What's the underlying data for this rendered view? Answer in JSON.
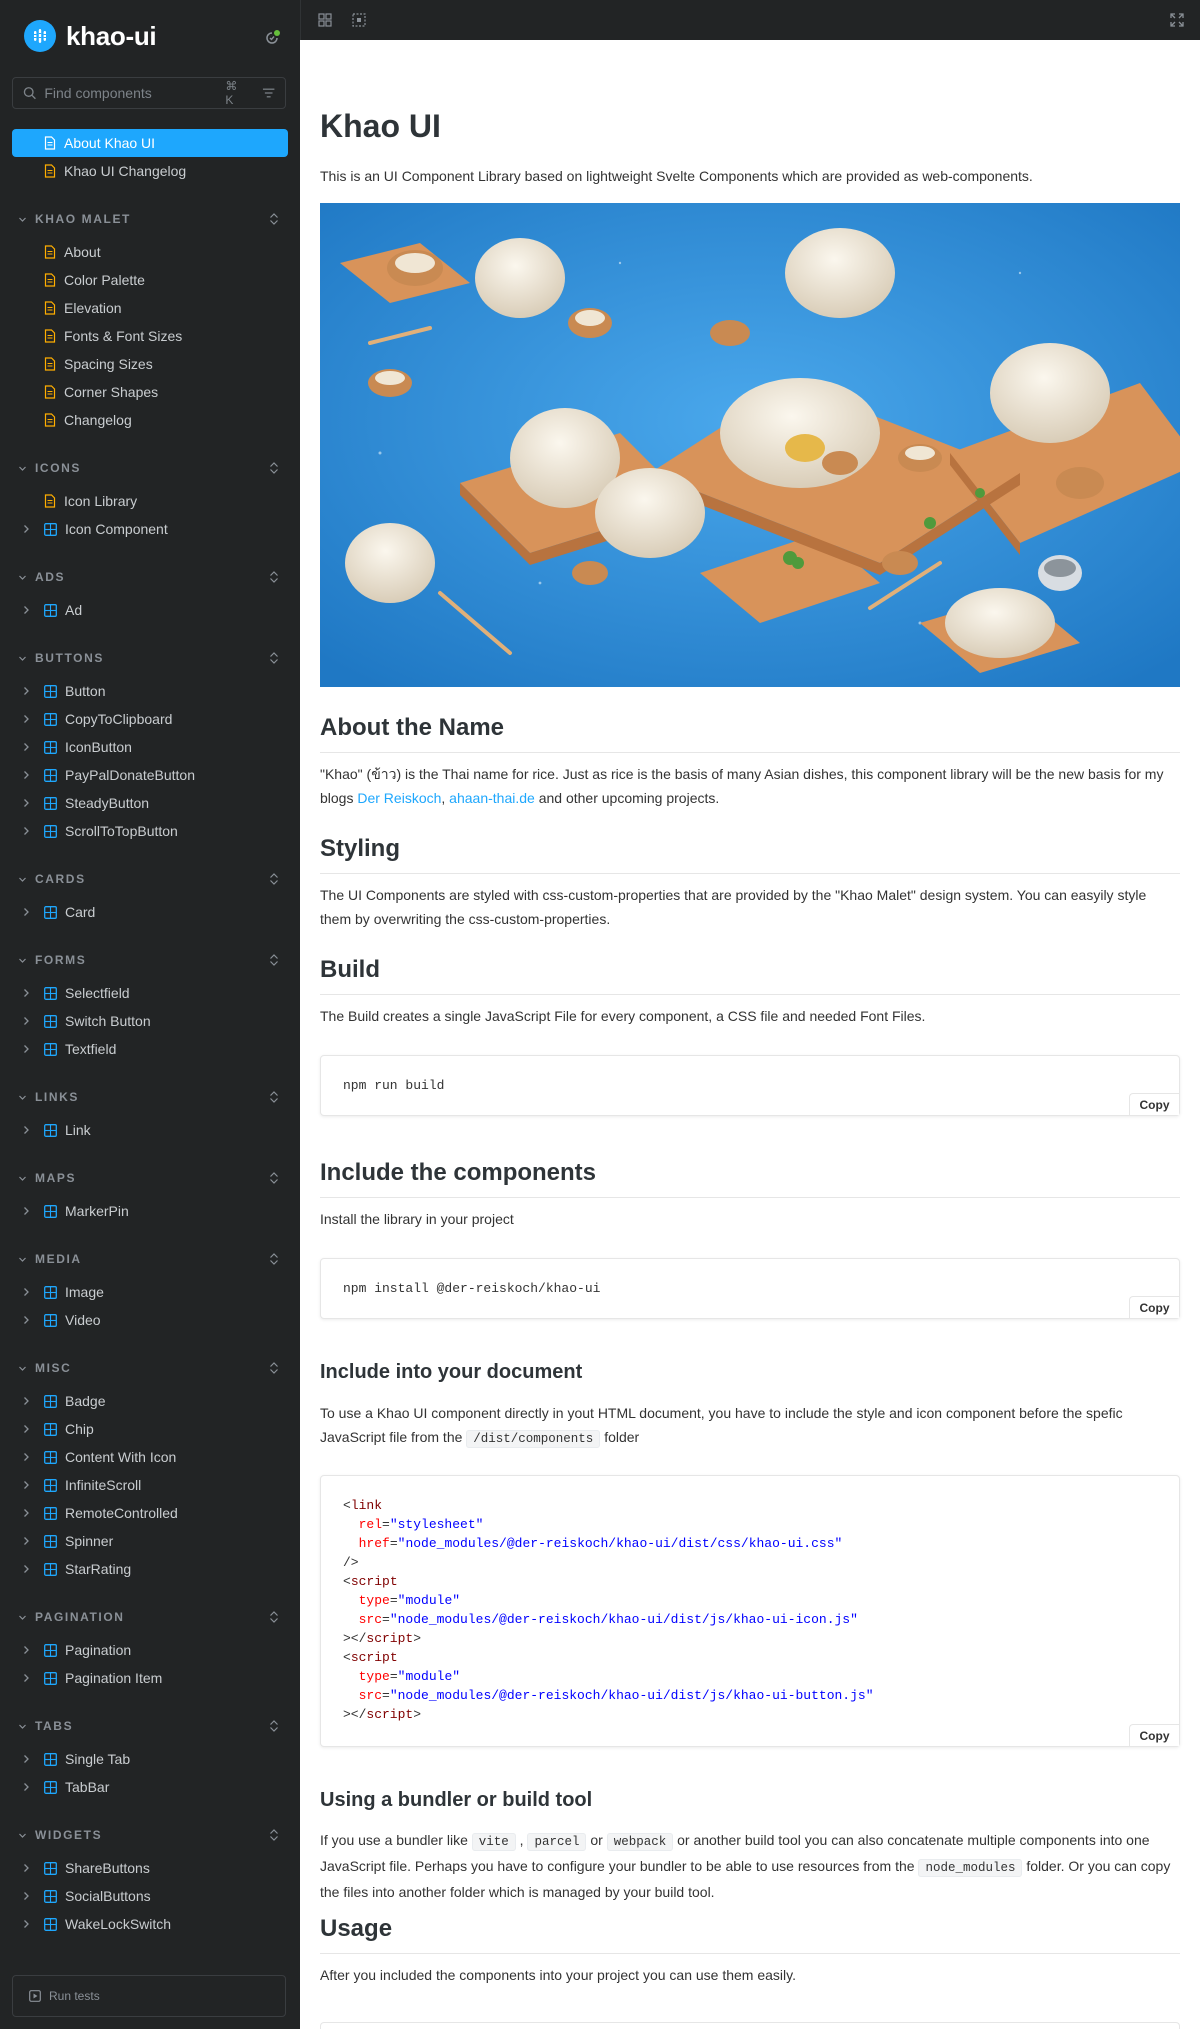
{
  "brand": {
    "name": "khao-ui"
  },
  "search": {
    "placeholder": "Find components",
    "shortcut": "⌘ K"
  },
  "sidebar": {
    "top_items": [
      {
        "label": "About Khao UI"
      },
      {
        "label": "Khao UI Changelog"
      }
    ],
    "sections": [
      {
        "title": "KHAO MALET",
        "items": [
          "About",
          "Color Palette",
          "Elevation",
          "Fonts & Font Sizes",
          "Spacing Sizes",
          "Corner Shapes",
          "Changelog"
        ]
      },
      {
        "title": "ICONS",
        "items": [
          "Icon Library",
          "Icon Component"
        ]
      },
      {
        "title": "ADS",
        "items": [
          "Ad"
        ]
      },
      {
        "title": "BUTTONS",
        "items": [
          "Button",
          "CopyToClipboard",
          "IconButton",
          "PayPalDonateButton",
          "SteadyButton",
          "ScrollToTopButton"
        ]
      },
      {
        "title": "CARDS",
        "items": [
          "Card"
        ]
      },
      {
        "title": "FORMS",
        "items": [
          "Selectfield",
          "Switch Button",
          "Textfield"
        ]
      },
      {
        "title": "LINKS",
        "items": [
          "Link"
        ]
      },
      {
        "title": "MAPS",
        "items": [
          "MarkerPin"
        ]
      },
      {
        "title": "MEDIA",
        "items": [
          "Image",
          "Video"
        ]
      },
      {
        "title": "MISC",
        "items": [
          "Badge",
          "Chip",
          "Content With Icon",
          "InfiniteScroll",
          "RemoteControlled",
          "Spinner",
          "StarRating"
        ]
      },
      {
        "title": "PAGINATION",
        "items": [
          "Pagination",
          "Pagination Item"
        ]
      },
      {
        "title": "TABS",
        "items": [
          "Single Tab",
          "TabBar"
        ]
      },
      {
        "title": "WIDGETS",
        "items": [
          "ShareButtons",
          "SocialButtons",
          "WakeLockSwitch"
        ]
      }
    ],
    "run_tests": "Run tests"
  },
  "colors": {
    "accent": "#1ea7fd",
    "sidebar_bg": "#222425",
    "doc_icon": "#ffae00",
    "status_dot": "#66bf3c"
  },
  "main": {
    "title": "Khao UI",
    "intro": "This is an UI Component Library based on lightweight Svelte Components which are provided as web-components.",
    "about_name": {
      "heading": "About the Name",
      "text1": "\"Khao\" (ข้าว) is the Thai name for rice. Just as rice is the basis of many Asian dishes, this component library will be the new basis for my blogs ",
      "link1": "Der Reiskoch",
      "sep": ", ",
      "link2": "ahaan-thai.de",
      "text2": " and other upcoming projects."
    },
    "styling": {
      "heading": "Styling",
      "text": "The UI Components are styled with css-custom-properties that are provided by the \"Khao Malet\" design system. You can easyily style them by overwriting the css-custom-properties."
    },
    "build": {
      "heading": "Build",
      "text": "The Build creates a single JavaScript File for every component, a CSS file and needed Font Files.",
      "code": "npm run build"
    },
    "include": {
      "heading": "Include the components",
      "text": "Install the library in your project",
      "code": "npm install @der-reiskoch/khao-ui"
    },
    "include_doc": {
      "heading": "Include into your document",
      "text1": "To use a Khao UI component directly in yout HTML document, you have to include the style and icon component before the spefic JavaScript file from the ",
      "code_inline": "/dist/components",
      "text2": " folder"
    },
    "bundler": {
      "heading": "Using a bundler or build tool",
      "t1": "If you use a bundler like ",
      "c1": "vite",
      "t2": " , ",
      "c2": "parcel",
      "t3": " or ",
      "c3": "webpack",
      "t4": " or another build tool you can also concatenate multiple components into one JavaScript file. Perhaps you have to configure your bundler to be able to use resources from the ",
      "c4": "node_modules",
      "t5": " folder. Or you can copy the files into another folder which is managed by your build tool."
    },
    "usage": {
      "heading": "Usage",
      "text": "After you included the components into your project you can use them easily."
    },
    "copy_label": "Copy"
  }
}
